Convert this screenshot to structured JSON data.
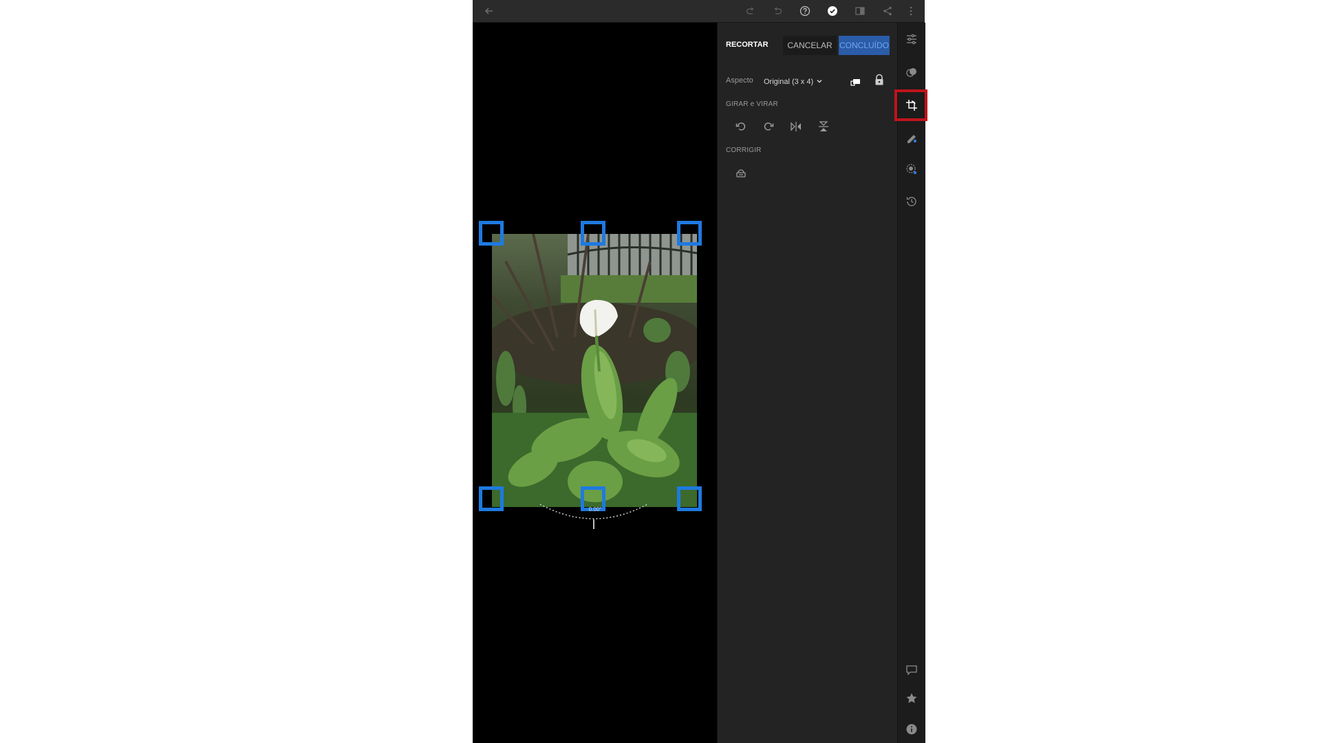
{
  "panel": {
    "title": "RECORTAR",
    "cancel_label": "CANCELAR",
    "done_label": "CONCLUÍDO",
    "aspect_label": "Aspecto",
    "aspect_value": "Original (3 x 4)",
    "rotate_section": "GIRAR e VIRAR",
    "straighten_section": "CORRIGIR"
  },
  "canvas": {
    "angle": "0.00°"
  },
  "colors": {
    "accent": "#2a5ca8",
    "handle": "#1e7ae0",
    "highlight": "#c0141c"
  }
}
